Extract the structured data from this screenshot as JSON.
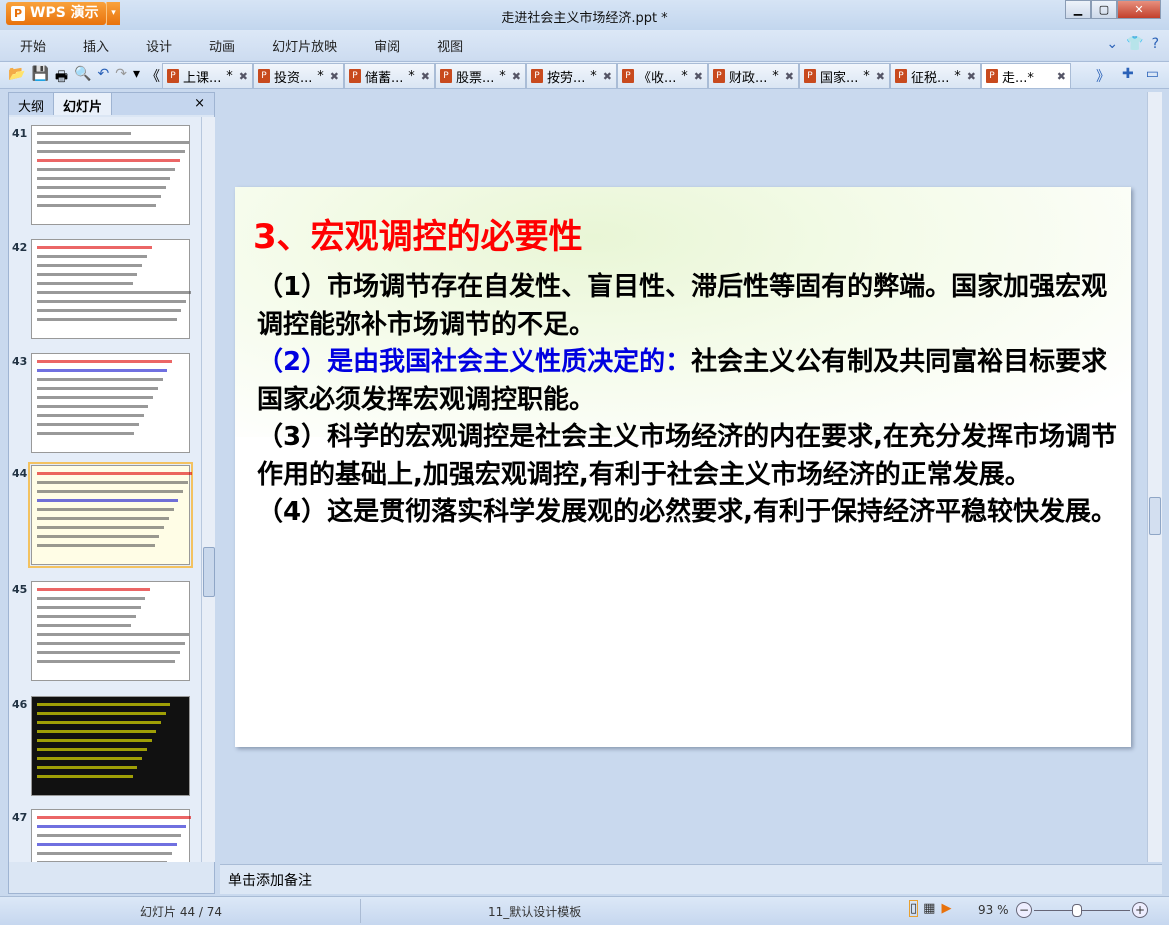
{
  "app": {
    "name": "WPS 演示",
    "title": "走进社会主义市场经济.ppt *"
  },
  "menu": [
    "开始",
    "插入",
    "设计",
    "动画",
    "幻灯片放映",
    "审阅",
    "视图"
  ],
  "doc_tabs": [
    {
      "label": "上课...",
      "mod": "*"
    },
    {
      "label": "投资...",
      "mod": "*"
    },
    {
      "label": "储蓄...",
      "mod": "*"
    },
    {
      "label": "股票...",
      "mod": "*"
    },
    {
      "label": "按劳...",
      "mod": "*"
    },
    {
      "label": "《收...",
      "mod": "*"
    },
    {
      "label": "财政...",
      "mod": "*"
    },
    {
      "label": "国家...",
      "mod": "*"
    },
    {
      "label": "征税...",
      "mod": "*"
    },
    {
      "label": "走...*",
      "mod": ""
    }
  ],
  "panel": {
    "tab_outline": "大纲",
    "tab_slides": "幻灯片",
    "close": "×"
  },
  "thumbnails": [
    "41",
    "42",
    "43",
    "44",
    "45",
    "46",
    "47"
  ],
  "slide": {
    "title": "3、宏观调控的必要性",
    "p1": "（1）市场调节存在自发性、盲目性、滞后性等固有的弊端。国家加强宏观调控能弥补市场调节的不足。",
    "p2_blue": "（2）是由我国社会主义性质决定的：",
    "p2_rest": "社会主义公有制及共同富裕目标要求国家必须发挥宏观调控职能。",
    "p3": "（3）科学的宏观调控是社会主义市场经济的内在要求,在充分发挥市场调节作用的基础上,加强宏观调控,有利于社会主义市场经济的正常发展。",
    "p4": "（4）这是贯彻落实科学发展观的必然要求,有利于保持经济平稳较快发展。"
  },
  "notes_placeholder": "单击添加备注",
  "status": {
    "slide": "幻灯片 44 / 74",
    "template": "11_默认设计模板",
    "zoom": "93 %",
    "zoom_percent": 93
  },
  "colors": {
    "title": "#ff0000",
    "highlight": "#0000e0",
    "accent": "#e8720c"
  }
}
